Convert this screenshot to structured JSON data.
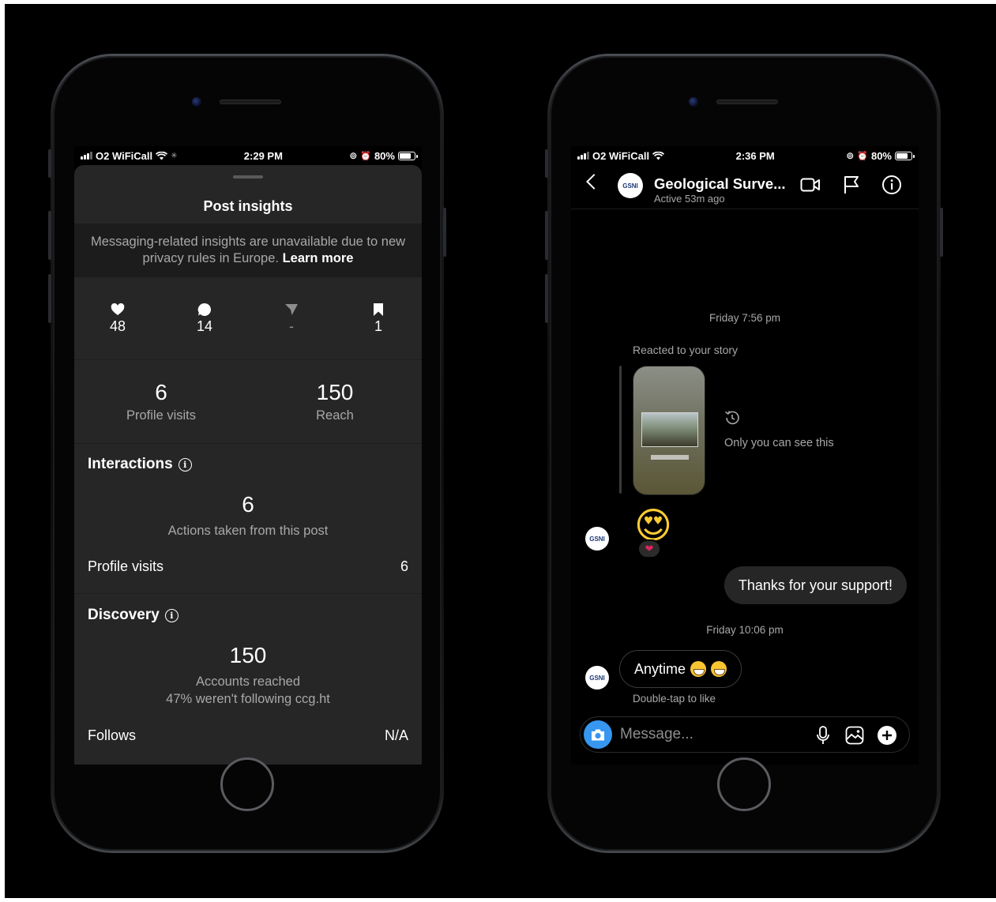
{
  "left_phone": {
    "status": {
      "carrier": "O2 WiFiCall",
      "time": "2:29 PM",
      "battery": "80%"
    },
    "title": "Post insights",
    "notice": {
      "text": "Messaging-related insights are unavailable due to new privacy rules in Europe.",
      "link": "Learn more"
    },
    "engagement": [
      {
        "icon": "heart-icon",
        "value": "48"
      },
      {
        "icon": "comment-icon",
        "value": "14"
      },
      {
        "icon": "share-icon",
        "value": "-"
      },
      {
        "icon": "bookmark-icon",
        "value": "1"
      }
    ],
    "overview": [
      {
        "value": "6",
        "label": "Profile visits"
      },
      {
        "value": "150",
        "label": "Reach"
      }
    ],
    "interactions": {
      "heading": "Interactions",
      "value": "6",
      "label": "Actions taken from this post",
      "row_label": "Profile visits",
      "row_value": "6"
    },
    "discovery": {
      "heading": "Discovery",
      "value": "150",
      "label": "Accounts reached",
      "sub": "47% weren't following ccg.ht",
      "row_label": "Follows",
      "row_value": "N/A"
    }
  },
  "right_phone": {
    "status": {
      "carrier": "O2 WiFiCall",
      "time": "2:36 PM",
      "battery": "80%"
    },
    "header": {
      "name": "Geological Surve...",
      "subtitle": "Active 53m ago",
      "avatar_text": "GSNI"
    },
    "messages": {
      "ts1": "Friday 7:56 pm",
      "reacted": "Reacted to your story",
      "only_you": "Only you can see this",
      "reaction_emoji": "😍",
      "reaction_badge": "❤",
      "outgoing": "Thanks for your support!",
      "ts2": "Friday 10:06 pm",
      "incoming": "Anytime",
      "double_tap": "Double-tap to like"
    },
    "composer": {
      "placeholder": "Message..."
    }
  }
}
